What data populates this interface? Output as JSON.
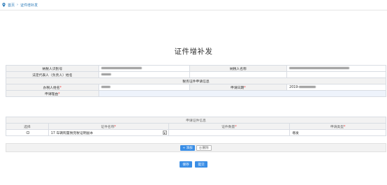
{
  "breadcrumb": {
    "home": "首页",
    "separator": "›",
    "current": "证件增补发"
  },
  "page_title": "证件增补发",
  "info": {
    "taxpayer_id_label": "纳税人识别号",
    "taxpayer_name_label": "纳税人名称",
    "legal_rep_label": "法定代表人（负责人）姓名",
    "section_title": "税务证件申请信息",
    "handler_label": "办税人姓名",
    "apply_date_label": "申请日期",
    "apply_date_value": "2019-",
    "reason_label": "申请理由",
    "required_mark": "*"
  },
  "cert": {
    "caption": "申请证件信息",
    "col_select": "选择",
    "col_name": "证件名称",
    "col_qty": "证件数量",
    "col_type": "申请类型",
    "row": {
      "name": "17 车辆购置税完税证明副本",
      "type": "增发"
    },
    "add_label": "+ 添加",
    "delete_label": "删除"
  },
  "actions": {
    "save_label": "保存",
    "submit_label": "提交"
  },
  "colors": {
    "accent": "#3a8ee6",
    "link": "#2a7ab8",
    "required": "#ee3333"
  },
  "icons": {
    "location": "location-pin-icon",
    "checkbox": "checkbox-icon",
    "dropdown": "chevron-down-icon",
    "delete": "trash-icon"
  }
}
